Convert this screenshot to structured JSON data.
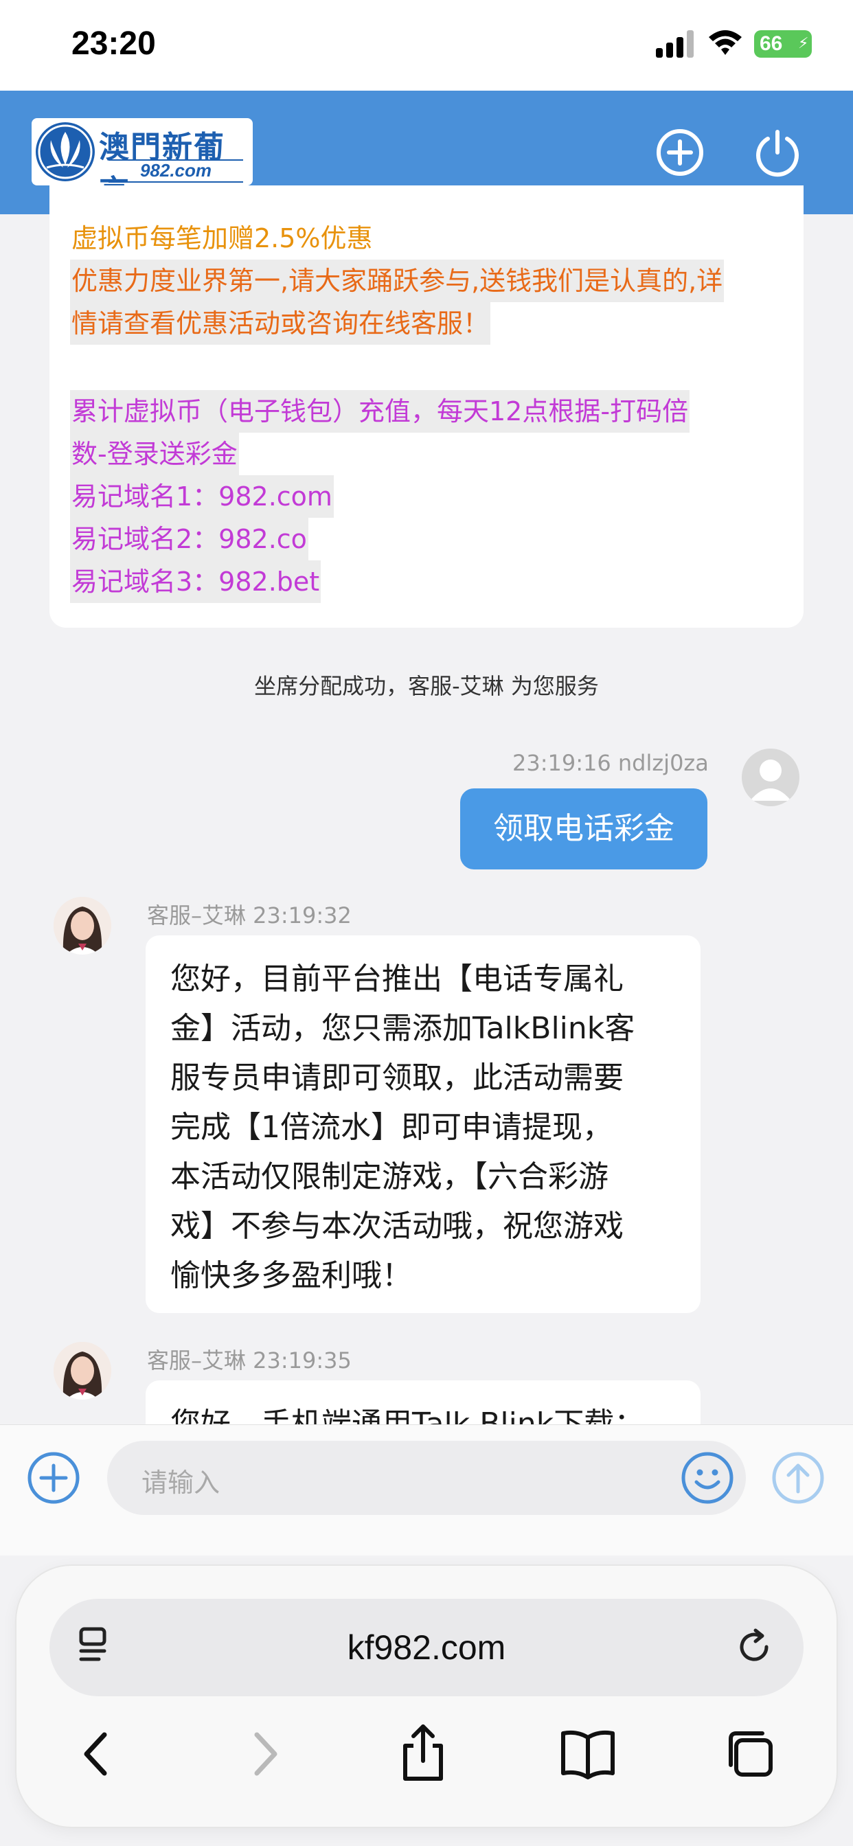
{
  "status_bar": {
    "time": "23:20",
    "battery": "66"
  },
  "header": {
    "logo_title": "澳門新葡京",
    "logo_sub": "982.com"
  },
  "notice": {
    "line1": "虚拟币每笔加赠2.5%优惠",
    "line2": "优惠力度业界第一,请大家踊跃参与,送钱我们是认真的,详",
    "line3": "情请查看优惠活动或咨询在线客服！",
    "line4": "累计虚拟币（电子钱包）充值，每天12点根据-打码倍",
    "line5": "数-登录送彩金",
    "line6": "易记域名1：982.com",
    "line7": "易记域名2：982.co",
    "line8": "易记域名3：982.bet"
  },
  "system_message": "坐席分配成功，客服-艾琳 为您服务",
  "messages": {
    "user1": {
      "meta": "23:19:16 ndlzj0za",
      "text": "领取电话彩金"
    },
    "agent1": {
      "meta": "客服–艾琳 23:19:32",
      "lines": [
        "您好，目前平台推出【电话专属礼",
        "金】活动，您只需添加TalkBlink客",
        "服专员申请即可领取，此活动需要",
        "完成【1倍流水】即可申请提现，",
        "本活动仅限制定游戏，【六合彩游",
        "戏】不参与本次活动哦，祝您游戏",
        "愉快多多盈利哦！"
      ]
    },
    "agent2": {
      "meta": "客服–艾琳 23:19:35",
      "text": "您好，手机端通用Talk Blink下载："
    }
  },
  "input": {
    "placeholder": "请输入"
  },
  "browser": {
    "url": "kf982.com"
  },
  "colors": {
    "header": "#4a90d9",
    "user_bubble": "#4a9ae6",
    "notice_orange": "#e8920c",
    "notice_orange_dark": "#e86a18",
    "notice_purple": "#c23ad6"
  },
  "icons": {
    "header_left": "plus-circle-icon",
    "header_right": "power-icon",
    "input_left": "plus-circle-icon",
    "input_emoji": "smiley-icon",
    "input_send": "send-up-arrow-icon",
    "url_left": "reader-icon",
    "url_right": "reload-icon",
    "toolbar": [
      "back-icon",
      "forward-icon",
      "share-icon",
      "bookmarks-icon",
      "tabs-icon"
    ]
  }
}
